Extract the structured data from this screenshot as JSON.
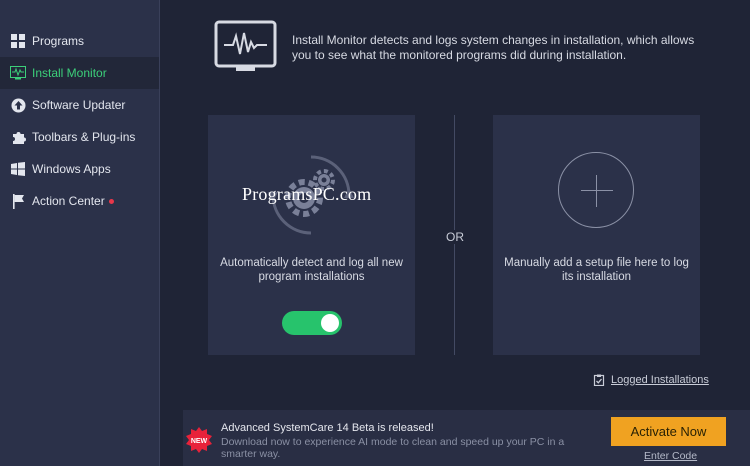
{
  "sidebar": {
    "items": [
      {
        "label": "Programs",
        "icon": "grid-icon"
      },
      {
        "label": "Install Monitor",
        "icon": "monitor-wave-icon",
        "active": true
      },
      {
        "label": "Software Updater",
        "icon": "arrow-up-circle-icon"
      },
      {
        "label": "Toolbars & Plug-ins",
        "icon": "puzzle-icon"
      },
      {
        "label": "Windows Apps",
        "icon": "windows-icon"
      },
      {
        "label": "Action Center",
        "icon": "flag-icon",
        "badge": true
      }
    ]
  },
  "main": {
    "intro": "Install Monitor detects and logs system changes in installation, which allows you to see what the monitored programs did during installation.",
    "auto_card": {
      "watermark": "ProgramsPC.com",
      "text": "Automatically detect and log all new program installations",
      "toggle_on": true
    },
    "or_label": "OR",
    "manual_card": {
      "text": "Manually add a setup file here to log its installation"
    },
    "logged_link": "Logged Installations"
  },
  "banner": {
    "title": "Advanced SystemCare 14 Beta is released!",
    "description": "Download now to experience AI mode to clean and speed up your PC in a smarter way.",
    "badge_text": "NEW",
    "activate_label": "Activate Now",
    "enter_code_label": "Enter Code"
  },
  "colors": {
    "accent_green": "#3ccf7a",
    "toggle_green": "#27c36c",
    "activate_orange": "#f0a221",
    "alert_red": "#e8374a"
  }
}
